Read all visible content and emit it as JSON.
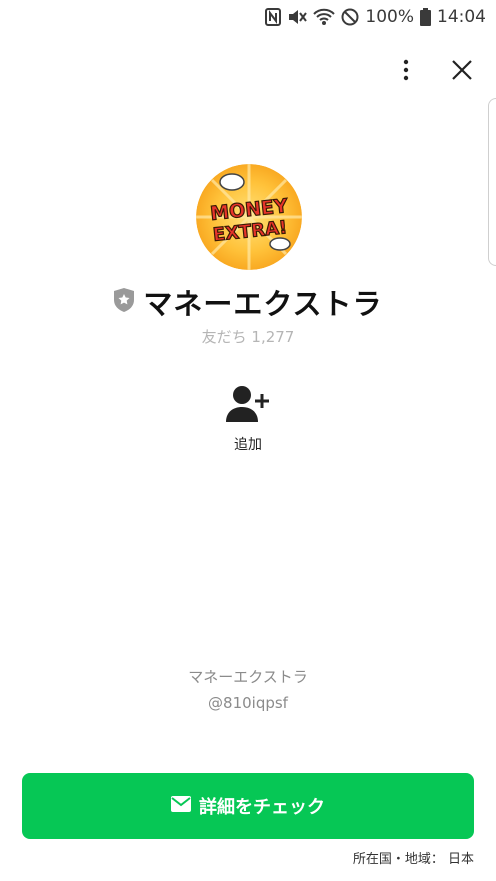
{
  "status_bar": {
    "battery": "100%",
    "time": "14:04",
    "icons": [
      "nfc-icon",
      "vibrate-mute-icon",
      "wifi-icon",
      "do-not-disturb-icon",
      "battery-icon"
    ]
  },
  "header": {
    "menu_icon": "more-vertical-icon",
    "close_icon": "close-icon"
  },
  "profile": {
    "avatar_text_line1": "MONEY",
    "avatar_text_line2": "EXTRA!",
    "badge_icon": "verified-shield-icon",
    "name": "マネーエクストラ",
    "friends_label": "友だち 1,277"
  },
  "actions": {
    "add_label": "追加"
  },
  "footer": {
    "account_name": "マネーエクストラ",
    "account_id": "@810iqpsf",
    "cta_label": "詳細をチェック",
    "region": "所在国・地域： 日本"
  },
  "colors": {
    "accent": "#06c755",
    "badge": "#9a9a9a"
  }
}
